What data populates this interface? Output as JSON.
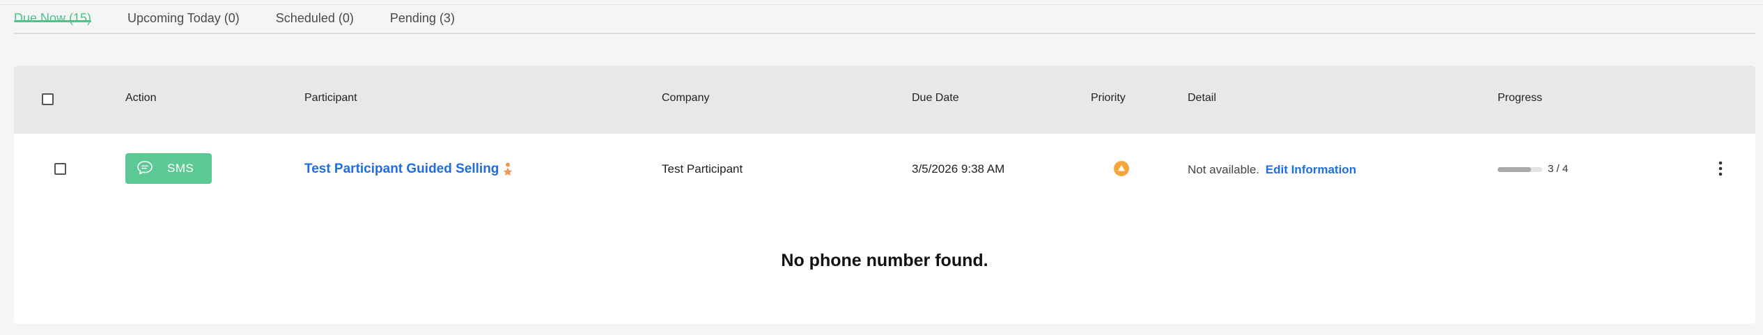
{
  "tabs": [
    {
      "label": "Due Now (15)"
    },
    {
      "label": "Upcoming Today (0)"
    },
    {
      "label": "Scheduled (0)"
    },
    {
      "label": "Pending (3)"
    }
  ],
  "table": {
    "columns": {
      "action": "Action",
      "participant": "Participant",
      "company": "Company",
      "due_date": "Due Date",
      "priority": "Priority",
      "detail": "Detail",
      "progress": "Progress"
    },
    "rows": [
      {
        "action_label": "SMS",
        "participant": "Test Participant Guided Selling",
        "company": "Test Participant",
        "due_date": "3/5/2026 9:38 AM",
        "priority_icon": "triangle-up-icon",
        "detail_text": "Not available.",
        "detail_link": "Edit Information",
        "progress_text": "3 / 4",
        "progress_fraction": 0.75
      }
    ],
    "empty_message": "No phone number found."
  },
  "colors": {
    "accent_green": "#4cc38a",
    "sms_button": "#5cc894",
    "link_blue": "#1f6de0",
    "priority_orange": "#f5a63a",
    "star_orange": "#e79a5a"
  }
}
